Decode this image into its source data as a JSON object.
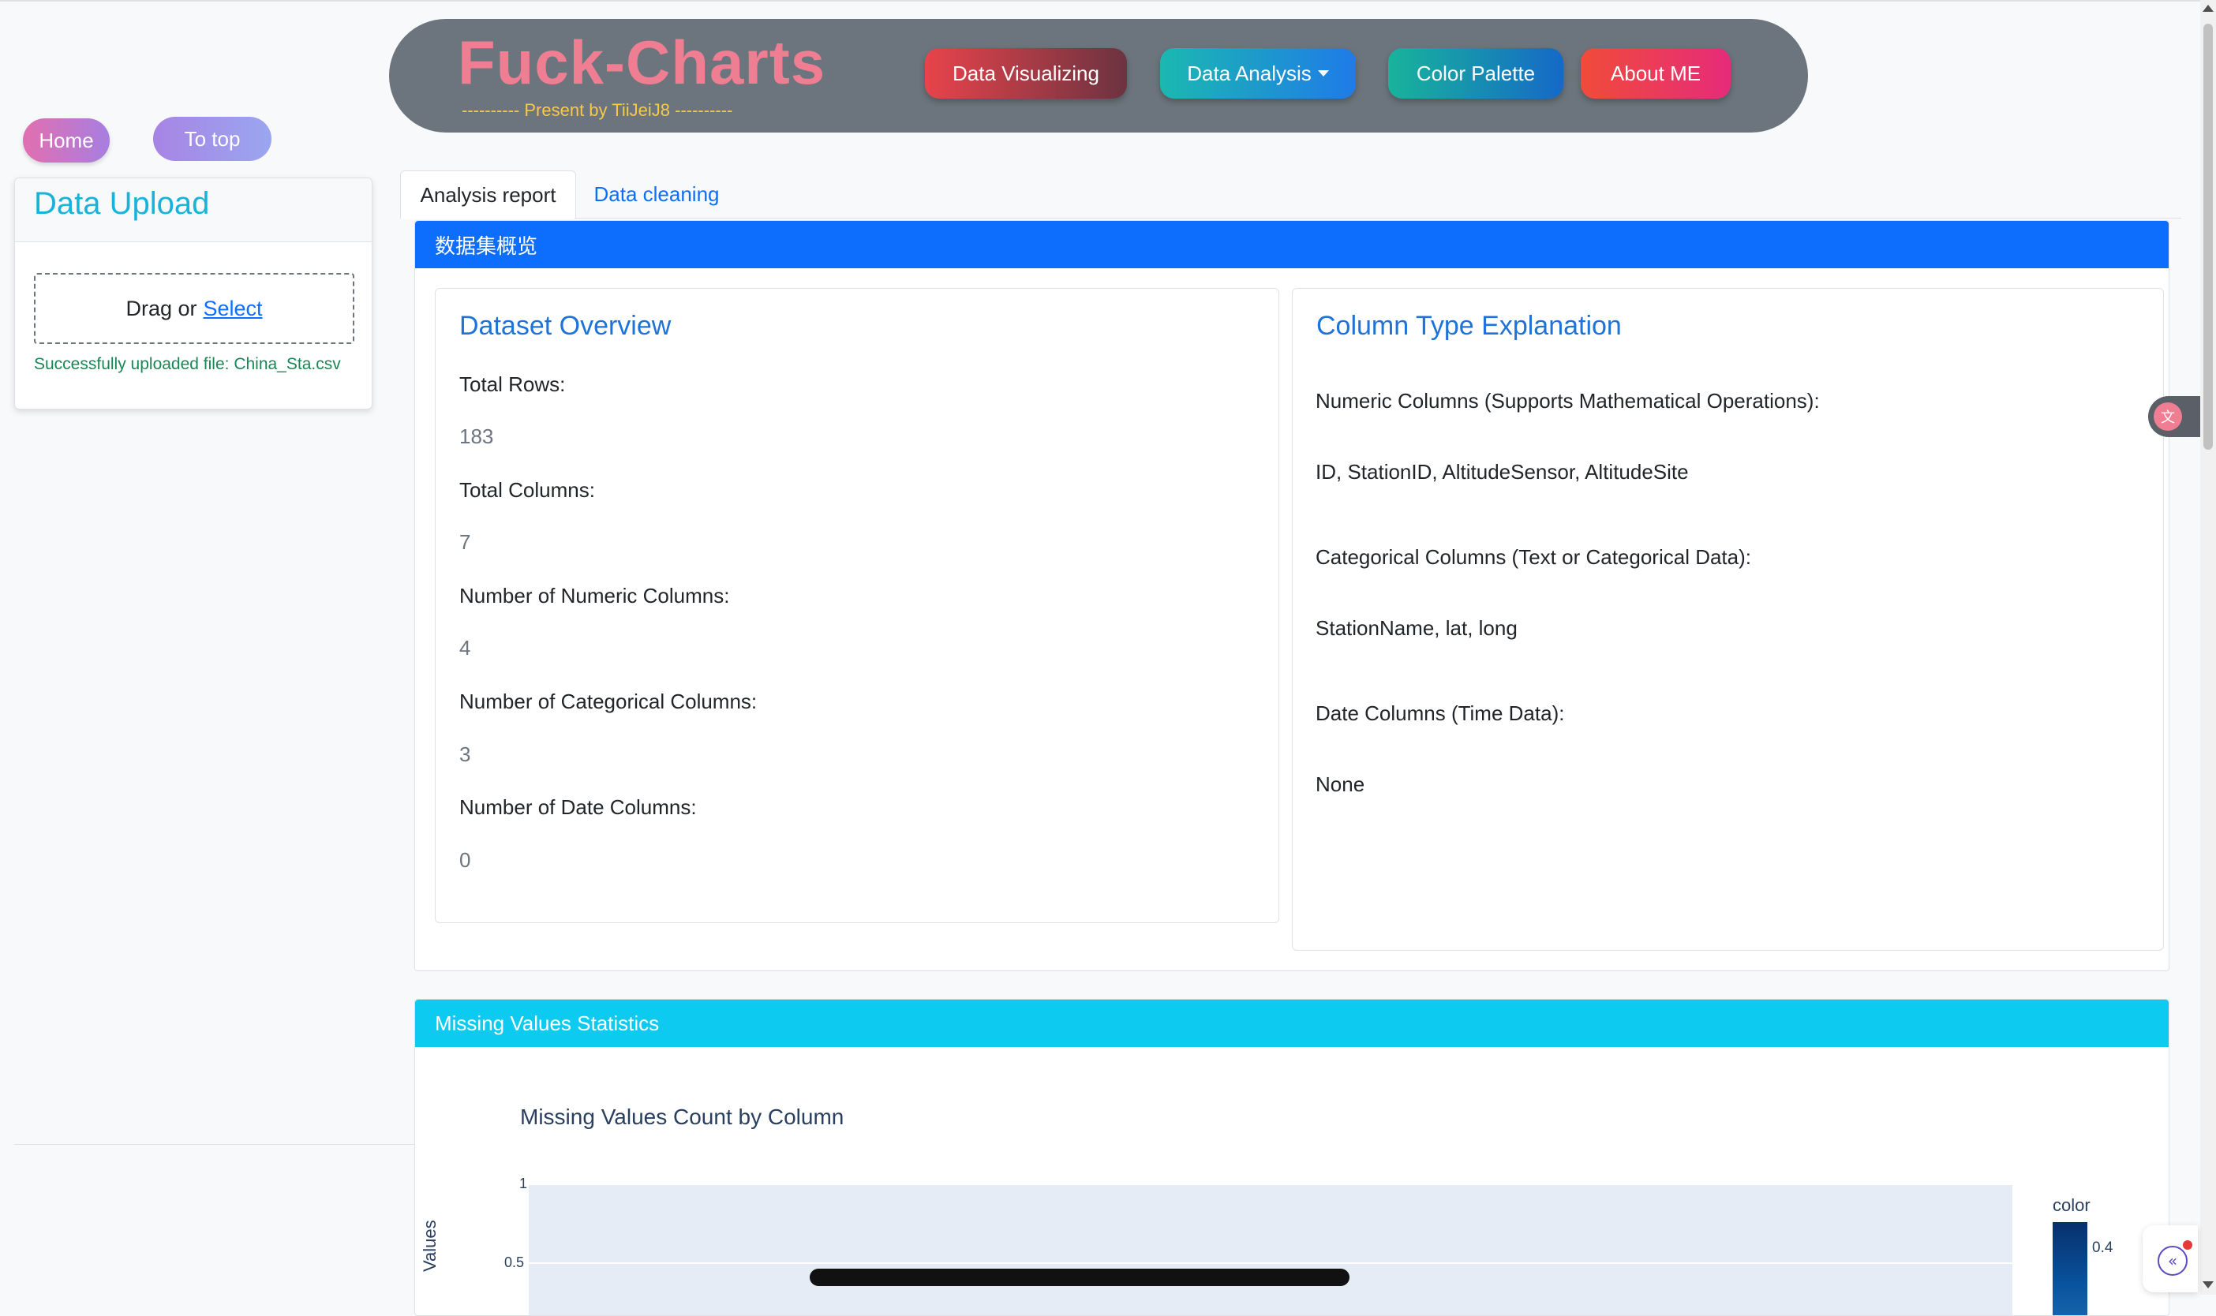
{
  "header": {
    "brand": "Fuck-Charts",
    "subtitle": "---------- Present by TiiJeiJ8 ----------",
    "nav": {
      "data_visualizing": "Data Visualizing",
      "data_analysis": "Data Analysis",
      "color_palette": "Color Palette",
      "about_me": "About ME"
    }
  },
  "sidebar": {
    "home_label": "Home",
    "to_top_label": "To top",
    "upload": {
      "title": "Data Upload",
      "drag_text": "Drag or",
      "select_text": "Select",
      "status": "Successfully uploaded file: China_Sta.csv"
    }
  },
  "tabs": [
    {
      "label": "Analysis report",
      "active": true
    },
    {
      "label": "Data cleaning",
      "active": false
    }
  ],
  "overview_section": {
    "header": "数据集概览",
    "dataset_overview": {
      "title": "Dataset Overview",
      "stats": [
        {
          "label": "Total Rows:",
          "value": "183"
        },
        {
          "label": "Total Columns:",
          "value": "7"
        },
        {
          "label": "Number of Numeric Columns:",
          "value": "4"
        },
        {
          "label": "Number of Categorical Columns:",
          "value": "3"
        },
        {
          "label": "Number of Date Columns:",
          "value": "0"
        }
      ]
    },
    "column_types": {
      "title": "Column Type Explanation",
      "groups": [
        {
          "label": "Numeric Columns (Supports Mathematical Operations):",
          "value": "ID, StationID, AltitudeSensor, AltitudeSite"
        },
        {
          "label": "Categorical Columns (Text or Categorical Data):",
          "value": "StationName, lat, long"
        },
        {
          "label": "Date Columns (Time Data):",
          "value": "None"
        }
      ]
    }
  },
  "missing_section": {
    "header": "Missing Values Statistics"
  },
  "chart_data": {
    "type": "bar",
    "title": "Missing Values Count by Column",
    "ylabel": "Values",
    "y_ticks": [
      "1",
      "0.5"
    ],
    "colorbar": {
      "title": "color",
      "tick": "0.4"
    },
    "colors": {
      "plot_bg": "#e5ecf6",
      "colorscale": [
        "#08306b",
        "#2171b5"
      ]
    }
  },
  "widgets": {
    "translate_icon": "translate-icon",
    "collapse_icon": "«"
  },
  "colors": {
    "primary": "#0d6efd",
    "info": "#0dcaf0",
    "header_bg": "#6c757d",
    "brand": "#f07e92",
    "success": "#198754"
  }
}
